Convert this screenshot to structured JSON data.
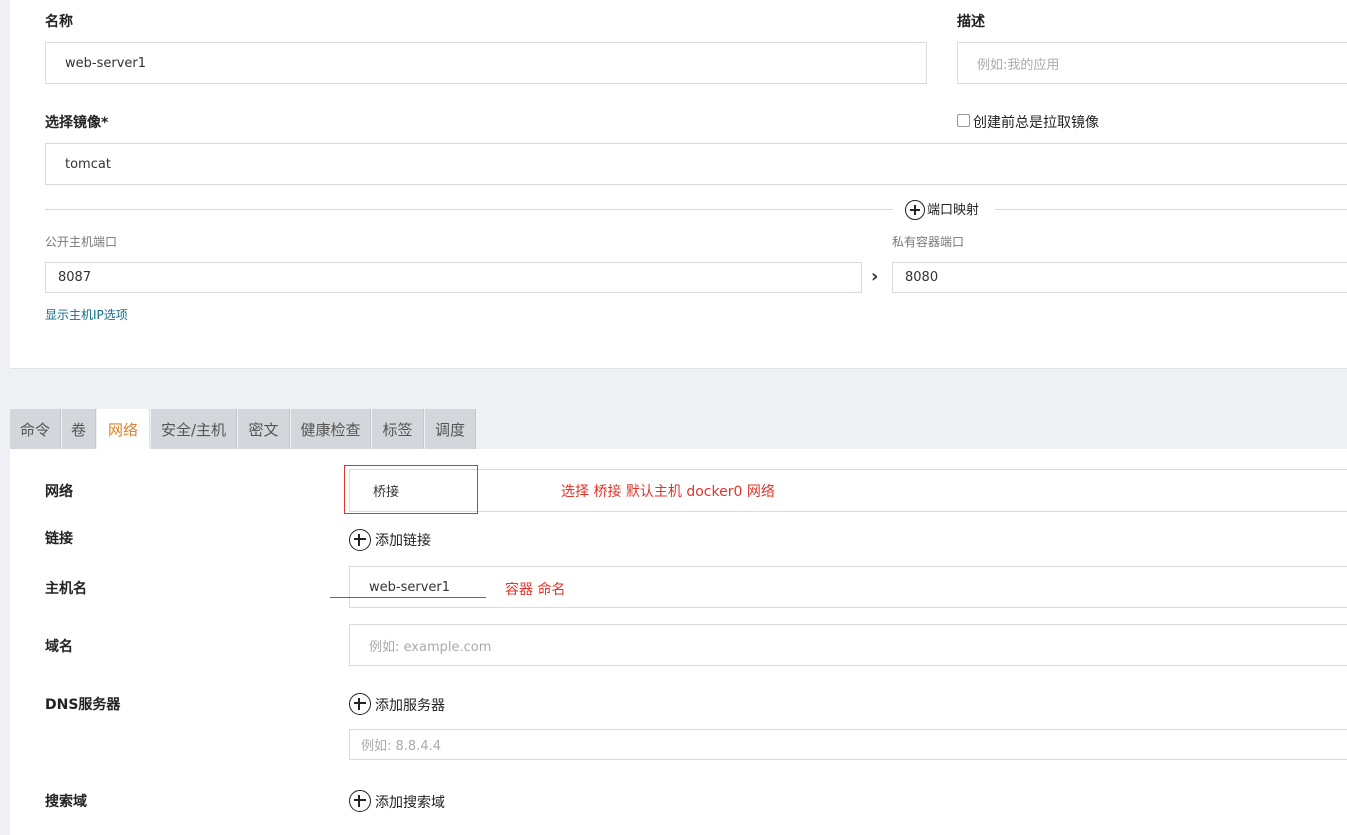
{
  "form": {
    "name_label": "名称",
    "name_value": "web-server1",
    "desc_label": "描述",
    "desc_placeholder": "例如:我的应用",
    "image_label": "选择镜像*",
    "image_value": "tomcat",
    "pull_label": "创建前总是拉取镜像",
    "port_mapping_label": "端口映射",
    "public_port_label": "公开主机端口",
    "public_port_value": "8087",
    "private_port_label": "私有容器端口",
    "private_port_value": "8080",
    "show_ip_link": "显示主机IP选项"
  },
  "tabs": [
    {
      "label": "命令"
    },
    {
      "label": "卷"
    },
    {
      "label": "网络"
    },
    {
      "label": "安全/主机"
    },
    {
      "label": "密文"
    },
    {
      "label": "健康检查"
    },
    {
      "label": "标签"
    },
    {
      "label": "调度"
    }
  ],
  "active_tab": "网络",
  "network": {
    "network_label": "网络",
    "network_value": "桥接",
    "link_label": "链接",
    "add_link": "添加链接",
    "hostname_label": "主机名",
    "hostname_value": "web-server1",
    "domain_label": "域名",
    "domain_placeholder": "例如: example.com",
    "dns_label": "DNS服务器",
    "add_dns": "添加服务器",
    "dns_placeholder": "例如: 8.8.4.4",
    "search_label": "搜索域",
    "add_search": "添加搜索域"
  },
  "annotations": {
    "network_note": "选择 桥接  默认主机 docker0 网络",
    "hostname_note": "容器 命名"
  },
  "colors": {
    "annotation": "#e0342c",
    "active_tab": "#d9822b",
    "link": "#0f6f8c"
  }
}
